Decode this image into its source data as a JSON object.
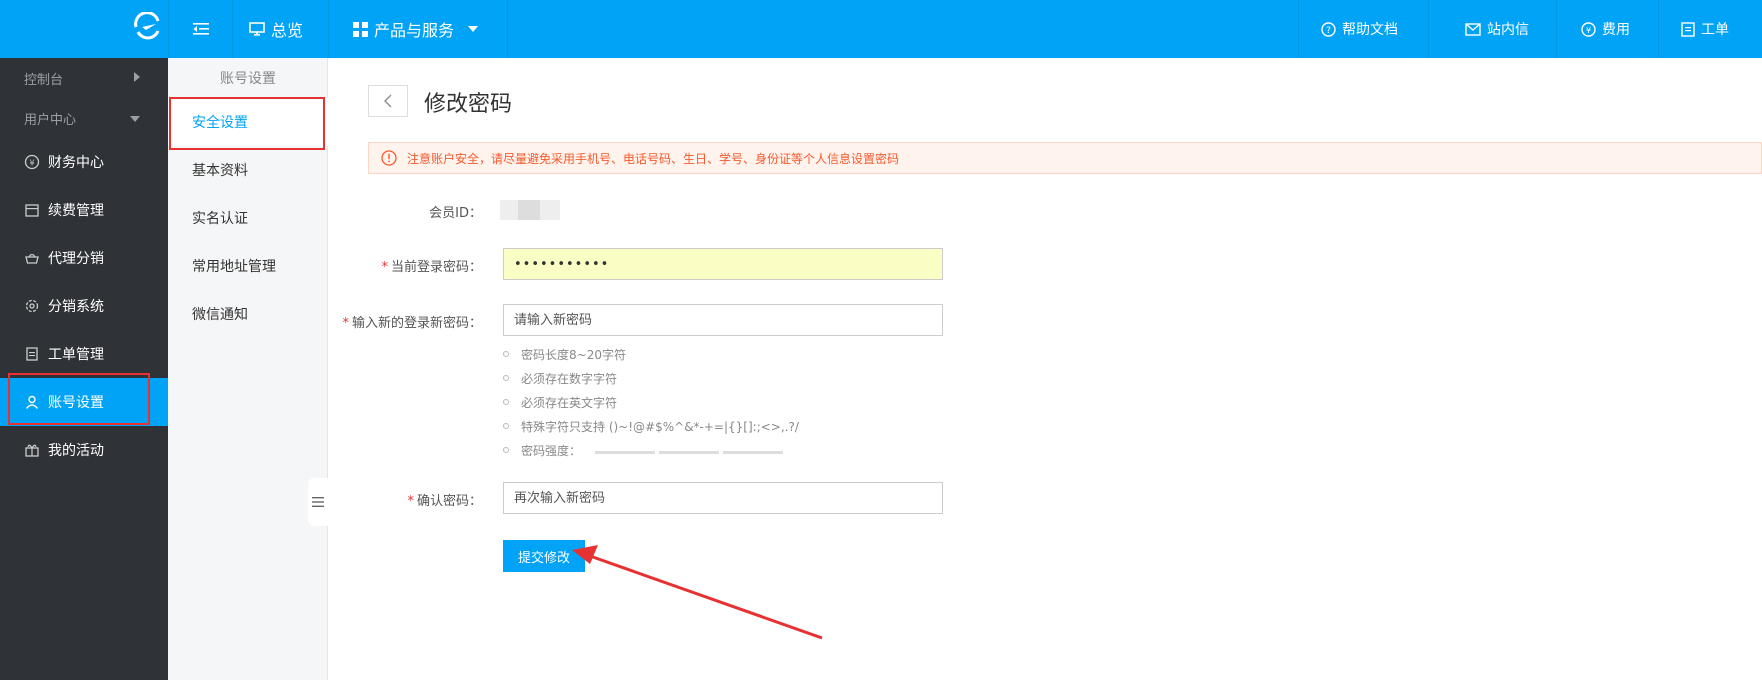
{
  "topbar": {
    "overview": "总览",
    "products": "产品与服务",
    "help": "帮助文档",
    "messages": "站内信",
    "fees": "费用",
    "tickets": "工单"
  },
  "sidebar": {
    "console": "控制台",
    "user_center": "用户中心",
    "items": [
      {
        "label": "财务中心",
        "icon": "yen-circle-icon"
      },
      {
        "label": "续费管理",
        "icon": "calendar-icon"
      },
      {
        "label": "代理分销",
        "icon": "basket-icon"
      },
      {
        "label": "分销系统",
        "icon": "gear-icon"
      },
      {
        "label": "工单管理",
        "icon": "document-icon"
      },
      {
        "label": "账号设置",
        "icon": "user-icon"
      },
      {
        "label": "我的活动",
        "icon": "gift-icon"
      }
    ]
  },
  "subnav": {
    "title": "账号设置",
    "items": [
      "安全设置",
      "基本资料",
      "实名认证",
      "常用地址管理",
      "微信通知"
    ]
  },
  "main": {
    "title": "修改密码",
    "notice": "注意账户安全，请尽量避免采用手机号、电话号码、生日、学号、身份证等个人信息设置密码",
    "member_id_label": "会员ID：",
    "current_pwd_label": "当前登录密码：",
    "current_pwd_value": "•••••••••••",
    "new_pwd_label": "输入新的登录新密码：",
    "new_pwd_placeholder": "请输入新密码",
    "rules": [
      "密码长度8~20字符",
      "必须存在数字字符",
      "必须存在英文字符",
      "特殊字符只支持 ()~!@#$%^&*-+=|{}[]:;<>,.?/"
    ],
    "strength_label": "密码强度：",
    "confirm_label": "确认密码：",
    "confirm_placeholder": "再次输入新密码",
    "submit": "提交修改"
  },
  "colors": {
    "brand": "#00a3f5",
    "sidebar_bg": "#2f3337",
    "highlight": "#e63232",
    "notice_text": "#f55a2c"
  }
}
